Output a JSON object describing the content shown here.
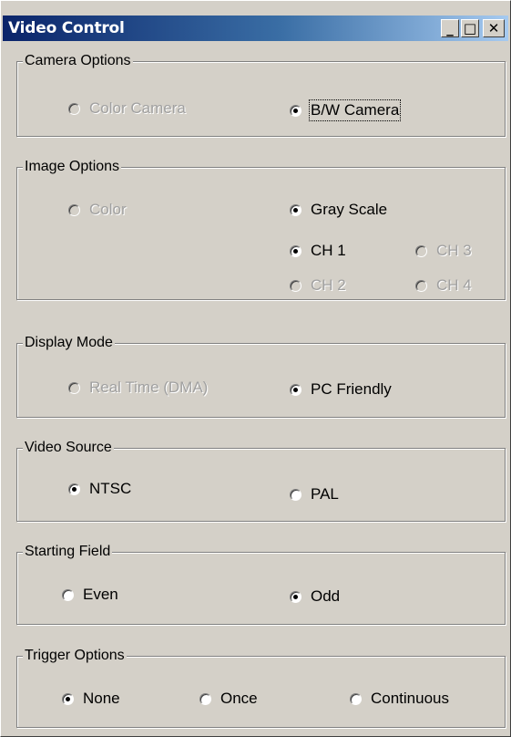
{
  "window": {
    "title": "Video Control",
    "controls": {
      "minimize": "_",
      "maximize": "□",
      "close": "✕"
    }
  },
  "camera_options": {
    "legend": "Camera Options",
    "options": [
      {
        "label": "Color Camera",
        "checked": false,
        "disabled": true
      },
      {
        "label": "B/W Camera",
        "checked": true,
        "disabled": false,
        "focused": true
      }
    ]
  },
  "image_options": {
    "legend": "Image Options",
    "options": [
      {
        "label": "Color",
        "checked": false,
        "disabled": true
      },
      {
        "label": "Gray Scale",
        "checked": true,
        "disabled": false
      },
      {
        "label": "CH 1",
        "checked": true,
        "disabled": false
      },
      {
        "label": "CH 3",
        "checked": false,
        "disabled": true
      },
      {
        "label": "CH 2",
        "checked": false,
        "disabled": true
      },
      {
        "label": "CH 4",
        "checked": false,
        "disabled": true
      }
    ]
  },
  "display_mode": {
    "legend": "Display Mode",
    "options": [
      {
        "label": "Real Time (DMA)",
        "checked": false,
        "disabled": true
      },
      {
        "label": "PC Friendly",
        "checked": true,
        "disabled": false
      }
    ]
  },
  "video_source": {
    "legend": "Video Source",
    "options": [
      {
        "label": "NTSC",
        "checked": true,
        "disabled": false
      },
      {
        "label": "PAL",
        "checked": false,
        "disabled": false
      }
    ]
  },
  "starting_field": {
    "legend": "Starting Field",
    "options": [
      {
        "label": "Even",
        "checked": false,
        "disabled": false
      },
      {
        "label": "Odd",
        "checked": true,
        "disabled": false
      }
    ]
  },
  "trigger_options": {
    "legend": "Trigger Options",
    "options": [
      {
        "label": "None",
        "checked": true,
        "disabled": false
      },
      {
        "label": "Once",
        "checked": false,
        "disabled": false
      },
      {
        "label": "Continuous",
        "checked": false,
        "disabled": false
      }
    ]
  }
}
